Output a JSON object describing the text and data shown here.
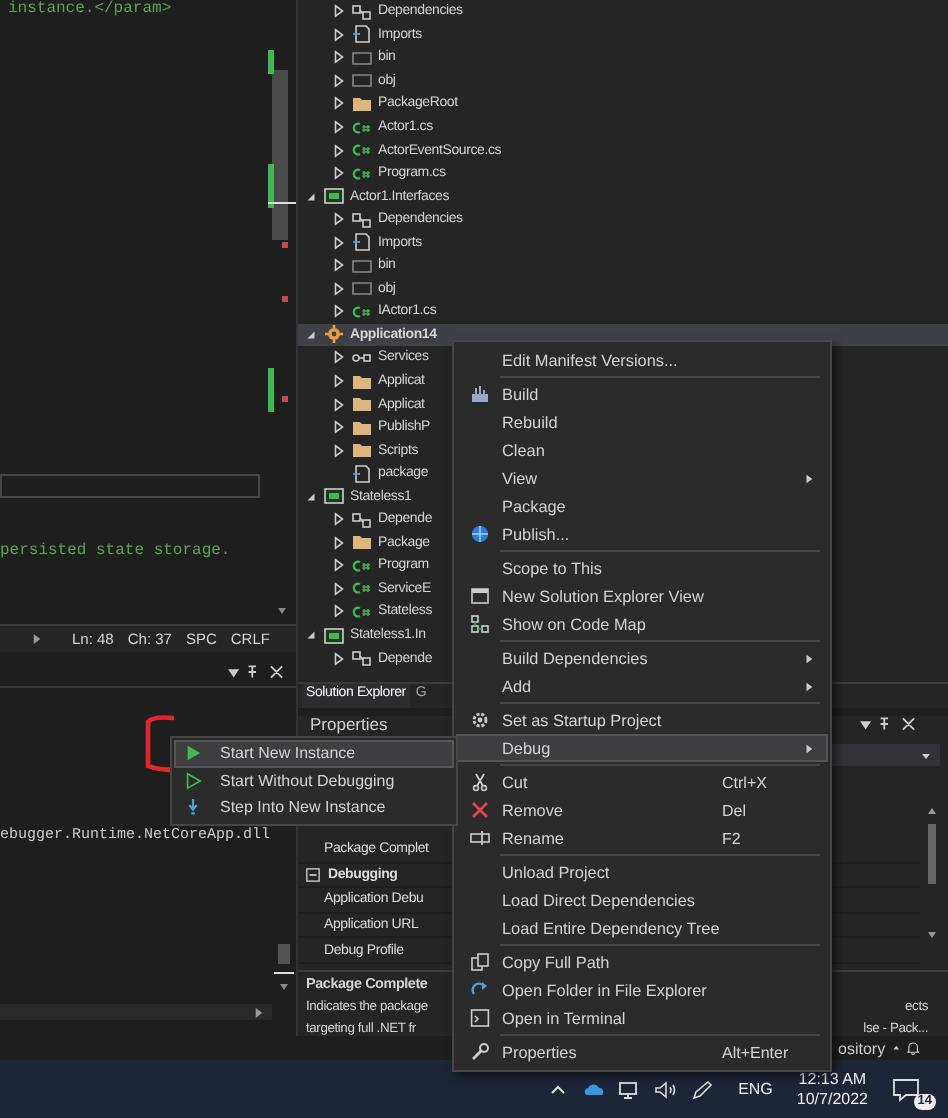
{
  "editor": {
    "code_lines": [
      "instance.</param>",
      "persisted state storage."
    ],
    "status": [
      "Ln: 48",
      "Ch: 37",
      "SPC",
      "CRLF"
    ]
  },
  "output": {
    "text": "ebugger.Runtime.NetCoreApp.dll"
  },
  "solution_explorer": {
    "items": [
      {
        "children": [
          {
            "label": "Dependencies",
            "kind": "dependencies",
            "expanded": false,
            "selected": false
          },
          {
            "label": "Imports",
            "kind": "imports",
            "expanded": false,
            "selected": false
          },
          {
            "label": "bin",
            "kind": "empty-folder",
            "expanded": false,
            "selected": false
          },
          {
            "label": "obj",
            "kind": "empty-folder",
            "expanded": false,
            "selected": false
          },
          {
            "label": "PackageRoot",
            "kind": "folder",
            "expanded": false,
            "selected": false
          },
          {
            "label": "Actor1.cs",
            "kind": "cs",
            "expanded": false,
            "selected": false
          },
          {
            "label": "ActorEventSource.cs",
            "kind": "cs",
            "expanded": false,
            "selected": false
          },
          {
            "label": "Program.cs",
            "kind": "cs",
            "expanded": false,
            "selected": false
          }
        ]
      },
      {
        "label": "Actor1.Interfaces",
        "kind": "project",
        "expanded": true,
        "selected": false,
        "children": [
          {
            "label": "Dependencies",
            "kind": "dependencies",
            "expanded": false,
            "selected": false
          },
          {
            "label": "Imports",
            "kind": "imports",
            "expanded": false,
            "selected": false
          },
          {
            "label": "bin",
            "kind": "empty-folder",
            "expanded": false,
            "selected": false
          },
          {
            "label": "obj",
            "kind": "empty-folder",
            "expanded": false,
            "selected": false
          },
          {
            "label": "IActor1.cs",
            "kind": "cs",
            "expanded": false,
            "selected": false
          }
        ]
      },
      {
        "label": "Application14",
        "kind": "app",
        "expanded": true,
        "selected": true,
        "children": [
          {
            "label": "Services",
            "kind": "services",
            "expanded": false,
            "selected": false
          },
          {
            "label": "Applicat",
            "kind": "folder",
            "expanded": false,
            "selected": false
          },
          {
            "label": "Applicat",
            "kind": "folder",
            "expanded": false,
            "selected": false
          },
          {
            "label": "PublishP",
            "kind": "folder",
            "expanded": false,
            "selected": false
          },
          {
            "label": "Scripts",
            "kind": "folder",
            "expanded": false,
            "selected": false
          },
          {
            "label": "package",
            "kind": "imports",
            "selected": false
          }
        ]
      },
      {
        "label": "Stateless1",
        "kind": "project",
        "expanded": true,
        "selected": false,
        "children": [
          {
            "label": "Depende",
            "kind": "dependencies",
            "expanded": false,
            "selected": false
          },
          {
            "label": "Package",
            "kind": "folder",
            "expanded": false,
            "selected": false
          },
          {
            "label": "Program",
            "kind": "cs",
            "expanded": false,
            "selected": false
          },
          {
            "label": "ServiceE",
            "kind": "cs",
            "expanded": false,
            "selected": false
          },
          {
            "label": "Stateless",
            "kind": "cs",
            "expanded": false,
            "selected": false
          }
        ]
      },
      {
        "label": "Stateless1.In",
        "kind": "project",
        "expanded": true,
        "selected": false,
        "children": [
          {
            "label": "Depende",
            "kind": "dependencies",
            "expanded": false,
            "selected": false
          }
        ]
      }
    ],
    "tabs": [
      {
        "label": "Solution Explorer",
        "selected": true
      },
      {
        "label": "G",
        "selected": false
      }
    ]
  },
  "properties": {
    "title": "Properties",
    "rows": [
      {
        "label": "Package Complet",
        "kind": "property"
      },
      {
        "label": "Debugging",
        "kind": "category",
        "expanded": true
      },
      {
        "label": "Application Debu",
        "kind": "property"
      },
      {
        "label": "Application URL",
        "kind": "property"
      },
      {
        "label": "Debug Profile",
        "kind": "property"
      }
    ],
    "description": {
      "title": "Package Complete",
      "lines": [
        {
          "start": "Indicates the package",
          "end": "ects"
        },
        {
          "start": "targeting full .NET fr",
          "end": "lse - Pack..."
        }
      ]
    }
  },
  "context_menu": {
    "items": [
      {
        "label": "Edit Manifest Versions...",
        "selected": false
      },
      {
        "label": "Build",
        "separator_before": true,
        "selected": false
      },
      {
        "label": "Rebuild",
        "selected": false
      },
      {
        "label": "Clean",
        "selected": false
      },
      {
        "label": "View",
        "submenu": true,
        "selected": false
      },
      {
        "label": "Package",
        "selected": false
      },
      {
        "label": "Publish...",
        "selected": false
      },
      {
        "label": "Scope to This",
        "separator_before": true,
        "selected": false
      },
      {
        "label": "New Solution Explorer View",
        "selected": false
      },
      {
        "label": "Show on Code Map",
        "selected": false
      },
      {
        "label": "Build Dependencies",
        "separator_before": true,
        "submenu": true,
        "selected": false
      },
      {
        "label": "Add",
        "submenu": true,
        "selected": false
      },
      {
        "label": "Set as Startup Project",
        "separator_before": true,
        "selected": false
      },
      {
        "label": "Debug",
        "submenu": true,
        "selected": true
      },
      {
        "label": "Cut",
        "separator_before": true,
        "shortcut": "Ctrl+X",
        "selected": false
      },
      {
        "label": "Remove",
        "shortcut": "Del",
        "selected": false
      },
      {
        "label": "Rename",
        "shortcut": "F2",
        "selected": false
      },
      {
        "label": "Unload Project",
        "separator_before": true,
        "selected": false
      },
      {
        "label": "Load Direct Dependencies",
        "selected": false
      },
      {
        "label": "Load Entire Dependency Tree",
        "selected": false
      },
      {
        "label": "Copy Full Path",
        "separator_before": true,
        "selected": false
      },
      {
        "label": "Open Folder in File Explorer",
        "selected": false
      },
      {
        "label": "Open in Terminal",
        "selected": false
      },
      {
        "label": "Properties",
        "separator_before": true,
        "shortcut": "Alt+Enter",
        "selected": false
      }
    ]
  },
  "debug_submenu": {
    "items": [
      {
        "label": "Start New Instance",
        "selected": true
      },
      {
        "label": "Start Without Debugging",
        "selected": false
      },
      {
        "label": "Step Into New Instance",
        "selected": false
      }
    ]
  },
  "status_bar": {
    "repository": "ository"
  },
  "taskbar": {
    "language": "ENG",
    "time": "12:13 AM",
    "date": "10/7/2022",
    "notifications": "14"
  }
}
